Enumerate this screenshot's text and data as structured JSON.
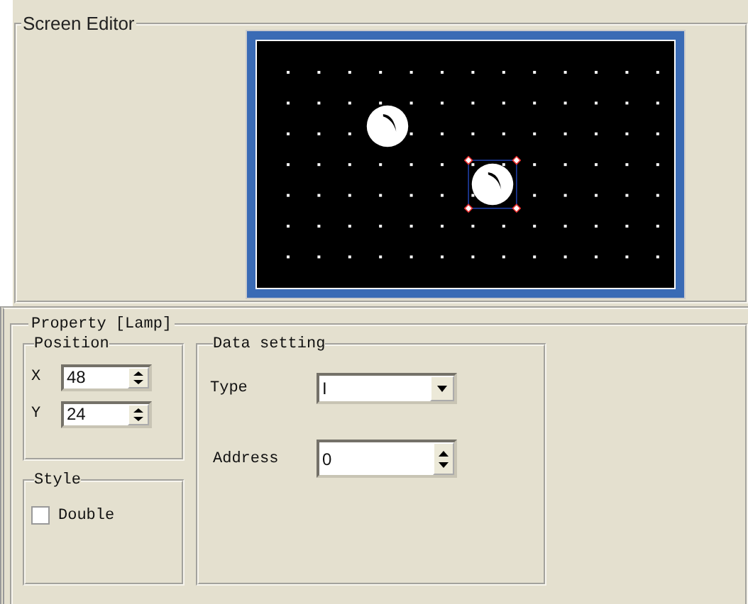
{
  "screen_editor": {
    "title": "Screen Editor",
    "lamps": [
      {
        "selected": false
      },
      {
        "selected": true
      }
    ]
  },
  "property": {
    "title": "Property",
    "object": "[Lamp]",
    "position": {
      "title": "Position",
      "x_label": "X",
      "x_value": "48",
      "y_label": "Y",
      "y_value": "24"
    },
    "style": {
      "title": "Style",
      "double": {
        "label": "Double",
        "checked": false
      }
    },
    "data_setting": {
      "title": "Data setting",
      "type_label": "Type",
      "type_value": "I",
      "address_label": "Address",
      "address_value": "0"
    }
  }
}
